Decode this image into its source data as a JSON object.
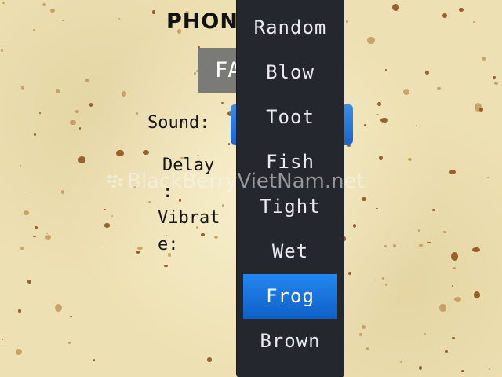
{
  "screen": {
    "title": "PHONE",
    "grey_button_label": "FART",
    "labels": {
      "sound": "Sound:",
      "delay": "Delay\n:",
      "vibrate": "Vibrat\ne:"
    },
    "selected_option": "Frog"
  },
  "sound_menu": {
    "options": [
      "Random",
      "Blow",
      "Toot",
      "Fish",
      "Tight",
      "Wet",
      "Frog",
      "Brown"
    ],
    "selected_index": 6
  },
  "watermark": {
    "text": "BlackBerryVietNam.net"
  },
  "colors": {
    "background": "#ede0b2",
    "menu_bg": "#24272e",
    "menu_text": "#e8eaed",
    "selected_bg": "#1a74e0",
    "grey_button": "#7a7a76",
    "blue_button": "#2a7ad8"
  }
}
